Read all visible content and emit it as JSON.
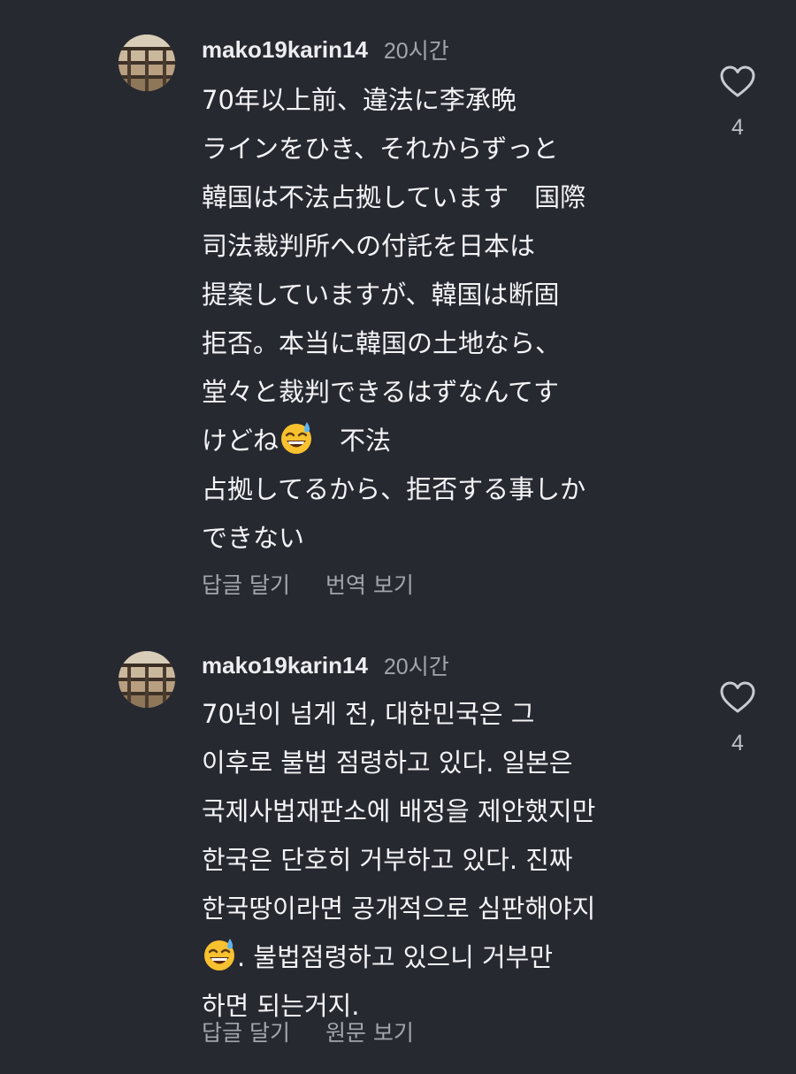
{
  "comments": [
    {
      "username": "mako19karin14",
      "time": "20시간",
      "lines": [
        "70年以上前、違法に李承晩",
        "ラインをひき、それからずっと",
        "韓国は不法占拠しています　国際",
        "司法裁判所への付託を日本は",
        "提案していますが、韓国は断固",
        "拒否。本当に韓国の土地なら、",
        "堂々と裁判できるはずなんてす"
      ],
      "emoji_line_before": "けどね",
      "emoji_line_after": "　不法",
      "lines_after": [
        "占拠してるから、拒否する事しか",
        "できない"
      ],
      "emoji": "grinning-sweat-emoji",
      "reply_label": "답글 달기",
      "translate_label": "번역 보기",
      "like_count": "4"
    },
    {
      "username": "mako19karin14",
      "time": "20시간",
      "lines": [
        "70년이 넘게 전, 대한민국은 그",
        "이후로 불법 점령하고 있다. 일본은",
        "국제사법재판소에 배정을 제안했지만",
        "한국은 단호히 거부하고 있다. 진짜",
        "한국땅이라면 공개적으로 심판해야지"
      ],
      "emoji_line_before": "",
      "emoji_line_after": ". 불법점령하고 있으니 거부만",
      "lines_after": [
        "하면 되는거지."
      ],
      "emoji": "grinning-sweat-emoji",
      "reply_label": "답글 달기",
      "translate_label": "원문 보기",
      "like_count": "4"
    }
  ],
  "icons": {
    "like": "heart-outline-icon"
  },
  "colors": {
    "background": "#272931",
    "text": "#f4f4f6",
    "muted": "#a3a5ad"
  }
}
